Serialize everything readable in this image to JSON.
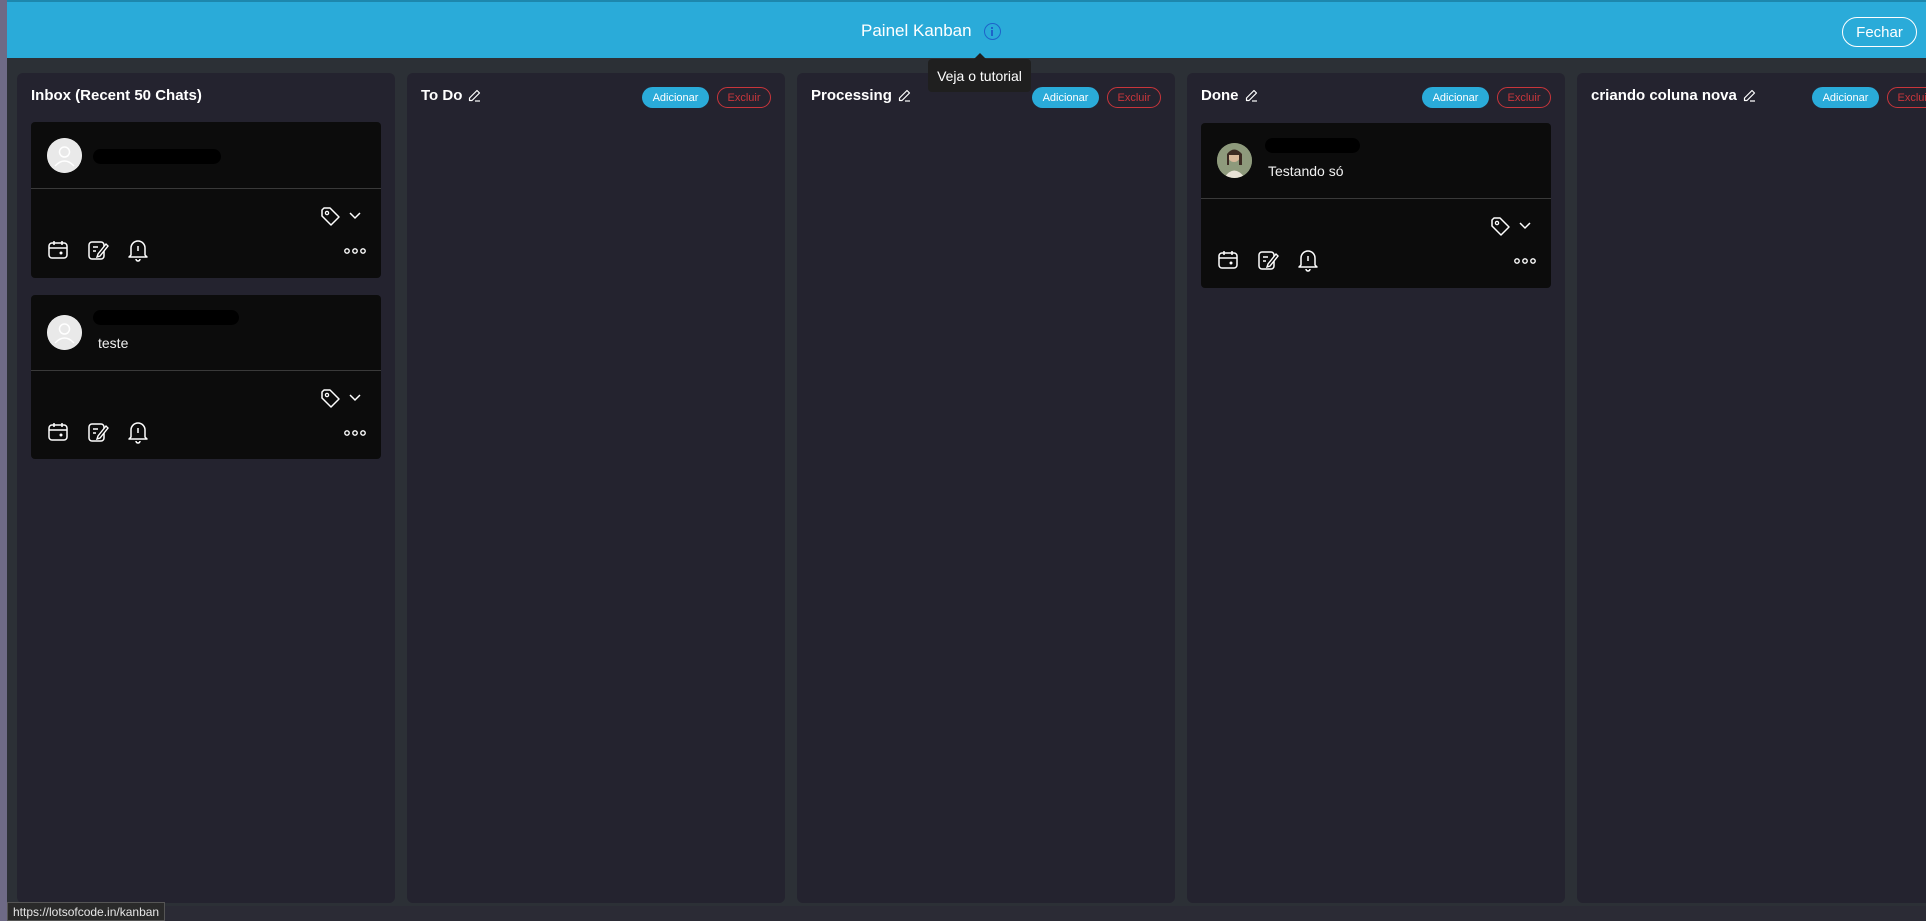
{
  "header": {
    "title": "Painel Kanban",
    "close_label": "Fechar",
    "tooltip": "Veja o tutorial"
  },
  "columns": [
    {
      "title": "Inbox (Recent 50 Chats)"
    },
    {
      "title": "To Do",
      "add_label": "Adicionar",
      "delete_label": "Excluir"
    },
    {
      "title": "Processing",
      "add_label": "Adicionar",
      "delete_label": "Excluir"
    },
    {
      "title": "Done",
      "add_label": "Adicionar",
      "delete_label": "Excluir"
    },
    {
      "title": "criando coluna nova",
      "add_label": "Adicionar",
      "delete_label": "Excluir"
    }
  ],
  "cards": {
    "inbox_1": {
      "message": ""
    },
    "inbox_2": {
      "message": "teste"
    },
    "done_1": {
      "message": "Testando só"
    }
  },
  "status_bar": {
    "url": "https://lotsofcode.in/kanban"
  },
  "colors": {
    "header": "#2aabd9",
    "column_bg": "#24232f",
    "card_bg": "#0c0c0c",
    "delete_red": "#c8353b"
  },
  "icons": [
    "info-icon",
    "pencil-icon",
    "tag-icon",
    "chevron-down-icon",
    "calendar-icon",
    "edit-note-icon",
    "bell-icon",
    "more-icon",
    "avatar-placeholder-icon"
  ]
}
